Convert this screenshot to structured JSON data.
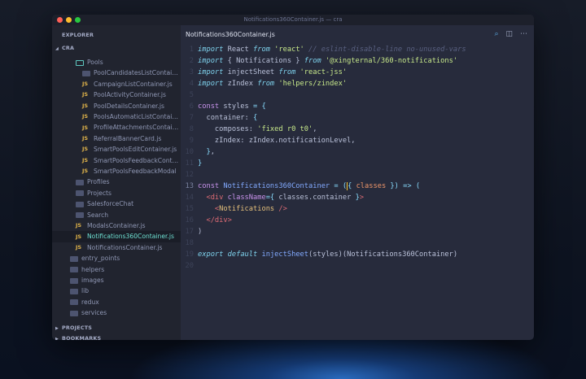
{
  "window": {
    "title": "Notifications360Container.js — cra",
    "traffic_colors": [
      "#fe5f57",
      "#febc2e",
      "#28c840"
    ]
  },
  "sidebar": {
    "explorer": "EXPLORER",
    "root": "CRA",
    "rows": [
      {
        "label": "Pools",
        "icon": "folder-open-icon",
        "depth": 2
      },
      {
        "label": "PoolCandidatesListContainer",
        "icon": "folder-icon",
        "depth": 3
      },
      {
        "label": "CampaignListContainer.js",
        "icon": "js-icon",
        "depth": 3
      },
      {
        "label": "PoolActivityContainer.js",
        "icon": "js-icon",
        "depth": 3
      },
      {
        "label": "PoolDetailsContainer.js",
        "icon": "js-icon",
        "depth": 3
      },
      {
        "label": "PoolsAutomaticListContainer",
        "icon": "js-icon",
        "depth": 3
      },
      {
        "label": "ProfileAttachmentsContainer",
        "icon": "js-icon",
        "depth": 3
      },
      {
        "label": "ReferralBannerCard.js",
        "icon": "js-icon",
        "depth": 3
      },
      {
        "label": "SmartPoolsEditContainer.js",
        "icon": "js-icon",
        "depth": 3
      },
      {
        "label": "SmartPoolsFeedbackContainer",
        "icon": "js-icon",
        "depth": 3
      },
      {
        "label": "SmartPoolsFeedbackModal",
        "icon": "js-icon",
        "depth": 3
      },
      {
        "label": "Profiles",
        "icon": "folder-icon",
        "depth": 2
      },
      {
        "label": "Projects",
        "icon": "folder-icon",
        "depth": 2
      },
      {
        "label": "SalesforceChat",
        "icon": "folder-icon",
        "depth": 2
      },
      {
        "label": "Search",
        "icon": "folder-icon",
        "depth": 2
      },
      {
        "label": "ModalsContainer.js",
        "icon": "js-icon",
        "depth": 2
      },
      {
        "label": "Notifications360Container.js",
        "icon": "js-icon",
        "depth": 2,
        "selected": true
      },
      {
        "label": "NotificationsContainer.js",
        "icon": "js-icon",
        "depth": 2
      },
      {
        "label": "entry_points",
        "icon": "folder-icon",
        "depth": 1
      },
      {
        "label": "helpers",
        "icon": "folder-icon",
        "depth": 1
      },
      {
        "label": "images",
        "icon": "folder-icon",
        "depth": 1
      },
      {
        "label": "lib",
        "icon": "folder-icon",
        "depth": 1
      },
      {
        "label": "redux",
        "icon": "folder-icon",
        "depth": 1
      },
      {
        "label": "services",
        "icon": "folder-icon",
        "depth": 1
      }
    ],
    "projects": "PROJECTS",
    "bookmarks": "BOOKMARKS"
  },
  "editor": {
    "tab": "Notifications360Container.js",
    "tools": [
      "search-file-icon",
      "split-editor-icon",
      "more-icon"
    ],
    "current_line": 13,
    "lines": [
      [
        [
          "kw",
          "import"
        ],
        [
          "pl",
          " React "
        ],
        [
          "kw",
          "from"
        ],
        [
          "pl",
          " "
        ],
        [
          "st",
          "'react'"
        ],
        [
          "pl",
          " "
        ],
        [
          "cm",
          "// eslint-disable-line no-unused-vars"
        ]
      ],
      [
        [
          "kw",
          "import"
        ],
        [
          "pl",
          " { Notifications } "
        ],
        [
          "kw",
          "from"
        ],
        [
          "pl",
          " "
        ],
        [
          "st",
          "'@xingternal/360-notifications'"
        ]
      ],
      [
        [
          "kw",
          "import"
        ],
        [
          "pl",
          " injectSheet "
        ],
        [
          "kw",
          "from"
        ],
        [
          "pl",
          " "
        ],
        [
          "st",
          "'react-jss'"
        ]
      ],
      [
        [
          "kw",
          "import"
        ],
        [
          "pl",
          " zIndex "
        ],
        [
          "kw",
          "from"
        ],
        [
          "pl",
          " "
        ],
        [
          "st",
          "'helpers/zindex'"
        ]
      ],
      [],
      [
        [
          "pu",
          "const"
        ],
        [
          "pl",
          " styles "
        ],
        [
          "op",
          "="
        ],
        [
          "pl",
          " "
        ],
        [
          "op",
          "{"
        ]
      ],
      [
        [
          "pl",
          "  container: "
        ],
        [
          "op",
          "{"
        ]
      ],
      [
        [
          "pl",
          "    composes: "
        ],
        [
          "st",
          "'fixed r0 t0'"
        ],
        [
          "pl",
          ","
        ]
      ],
      [
        [
          "pl",
          "    zIndex: zIndex.notificationLevel,"
        ]
      ],
      [
        [
          "op",
          "  }"
        ],
        [
          "pl",
          ","
        ]
      ],
      [
        [
          "op",
          "}"
        ]
      ],
      [],
      [
        [
          "pu",
          "const"
        ],
        [
          "pl",
          " "
        ],
        [
          "fn",
          "Notifications360Container"
        ],
        [
          "pl",
          " "
        ],
        [
          "op",
          "="
        ],
        [
          "pl",
          " "
        ],
        [
          "op",
          "("
        ],
        [
          "caret",
          ""
        ],
        [
          "op",
          "{"
        ],
        [
          "pl",
          " "
        ],
        [
          "or",
          "classes"
        ],
        [
          "pl",
          " "
        ],
        [
          "op",
          "})"
        ],
        [
          "pl",
          " "
        ],
        [
          "op",
          "=>"
        ],
        [
          "pl",
          " "
        ],
        [
          "op",
          "("
        ]
      ],
      [
        [
          "pl",
          "  "
        ],
        [
          "tg",
          "<div"
        ],
        [
          "pl",
          " "
        ],
        [
          "pu",
          "className"
        ],
        [
          "op",
          "={"
        ],
        [
          "pl",
          " classes.container "
        ],
        [
          "op",
          "}"
        ],
        [
          "tg",
          ">"
        ]
      ],
      [
        [
          "pl",
          "    "
        ],
        [
          "tg",
          "<"
        ],
        [
          "cp",
          "Notifications"
        ],
        [
          "pl",
          " "
        ],
        [
          "tg",
          "/>"
        ]
      ],
      [
        [
          "pl",
          "  "
        ],
        [
          "tg",
          "</div>"
        ]
      ],
      [
        [
          "pl",
          ")"
        ]
      ],
      [],
      [
        [
          "kw",
          "export"
        ],
        [
          "pl",
          " "
        ],
        [
          "kw",
          "default"
        ],
        [
          "pl",
          " "
        ],
        [
          "fn",
          "injectSheet"
        ],
        [
          "pl",
          "(styles)(Notifications360Container)"
        ]
      ],
      []
    ]
  }
}
